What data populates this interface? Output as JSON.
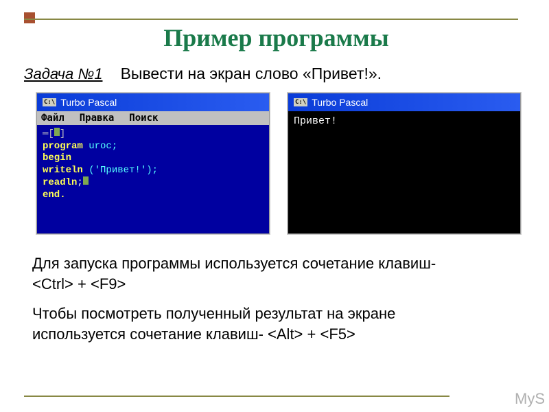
{
  "title": "Пример программы",
  "task": {
    "label": "Задача №1",
    "text": "Вывести на экран слово «Привет!»."
  },
  "window1": {
    "title": "Turbo Pascal",
    "icon": "C:\\",
    "menu": {
      "file": "Файл",
      "edit": "Правка",
      "search": "Поиск"
    },
    "code": {
      "bracket": "═[",
      "l1_kw": "program",
      "l1_ident": "uroc;",
      "l2_kw": "begin",
      "l3a": "writeln",
      "l3b": " ('Привет!');",
      "l4a": "readln",
      "l4b": ";",
      "l5_kw": "end."
    }
  },
  "window2": {
    "title": "Turbo Pascal",
    "icon": "C:\\",
    "output": "Привет!"
  },
  "instr1": {
    "line1": "Для запуска программы используется сочетание клавиш-",
    "line2": "<Ctrl> + <F9>"
  },
  "instr2": {
    "line1": "Чтобы посмотреть полученный результат на экране",
    "line2": "используется сочетание клавиш- <Alt> + <F5>"
  },
  "watermark": "MyS"
}
